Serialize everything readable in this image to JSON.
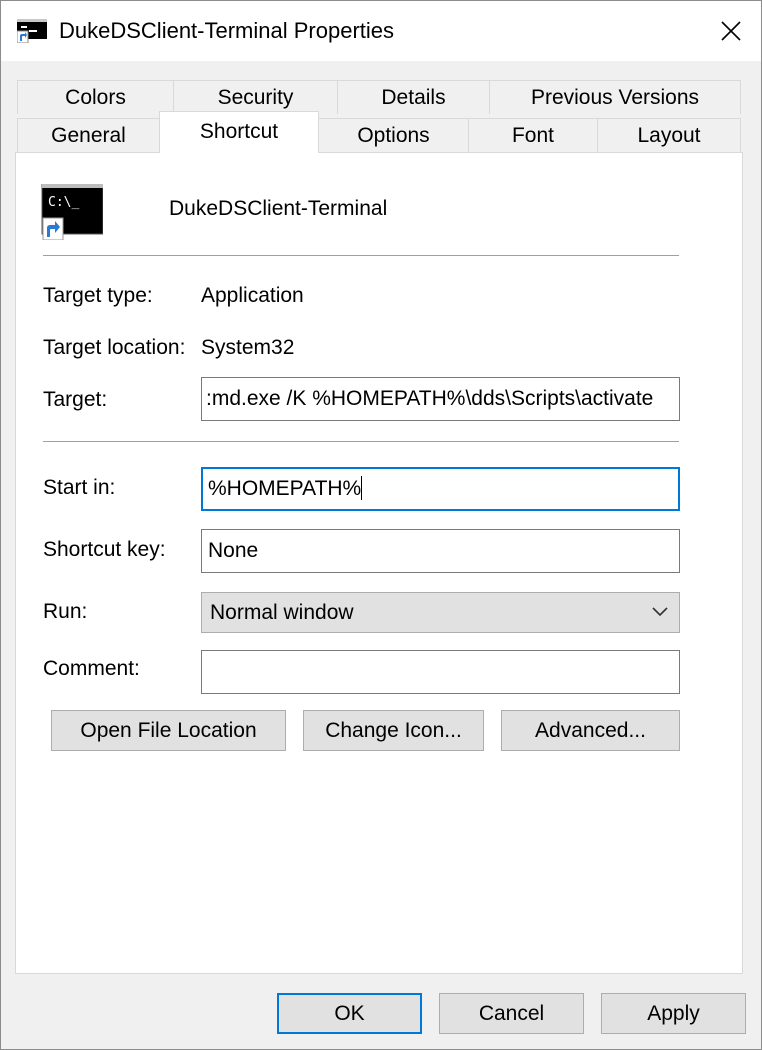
{
  "window": {
    "title": "DukeDSClient-Terminal Properties",
    "close_glyph": "✕"
  },
  "tabs": {
    "row1": [
      "Colors",
      "Security",
      "Details",
      "Previous Versions"
    ],
    "row2": [
      "General",
      "Shortcut",
      "Options",
      "Font",
      "Layout"
    ],
    "active": "Shortcut"
  },
  "shortcut": {
    "name": "DukeDSClient-Terminal",
    "icon_text": "C:\\_",
    "target_type_label": "Target type:",
    "target_type_value": "Application",
    "target_location_label": "Target location:",
    "target_location_value": "System32",
    "target_label": "Target:",
    "target_value": ":md.exe /K %HOMEPATH%\\dds\\Scripts\\activate",
    "start_in_label": "Start in:",
    "start_in_value": "%HOMEPATH%",
    "shortcut_key_label": "Shortcut key:",
    "shortcut_key_value": "None",
    "run_label": "Run:",
    "run_value": "Normal window",
    "comment_label": "Comment:",
    "comment_value": "",
    "open_file_location_label": "Open File Location",
    "change_icon_label": "Change Icon...",
    "advanced_label": "Advanced..."
  },
  "footer": {
    "ok_label": "OK",
    "cancel_label": "Cancel",
    "apply_label": "Apply"
  },
  "colors": {
    "accent": "#0078d7",
    "button_face": "#e1e1e1",
    "panel": "#ffffff",
    "window_bg": "#f0f0f0"
  }
}
